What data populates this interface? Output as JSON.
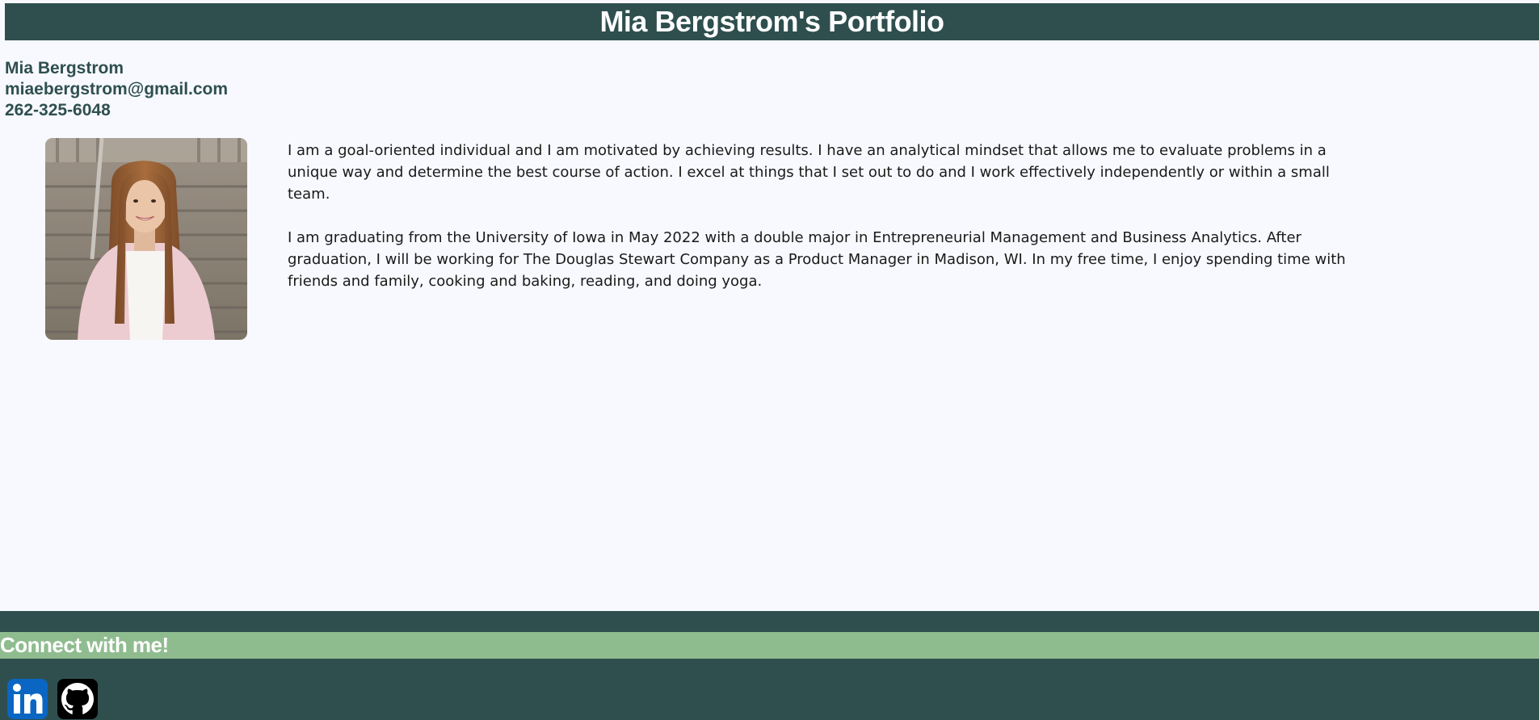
{
  "header": {
    "title": "Mia Bergstrom's Portfolio"
  },
  "contact": {
    "name": "Mia Bergstrom",
    "email": "miaebergstrom@gmail.com",
    "phone": "262-325-6048"
  },
  "bio": {
    "paragraph1": "I am a goal-oriented individual and I am motivated by achieving results. I have an analytical mindset that allows me to evaluate problems in a unique way and determine the best course of action. I excel at things that I set out to do and I work effectively independently or within a small team.",
    "paragraph2": "I am graduating from the University of Iowa in May 2022 with a double major in Entrepreneurial Management and Business Analytics. After graduation, I will be working for The Douglas Stewart Company as a Product Manager in Madison, WI. In my free time, I enjoy spending time with friends and family, cooking and baking, reading, and doing yoga."
  },
  "footer": {
    "connect_label": "Connect with me!",
    "social_icons": [
      "linkedin-icon",
      "github-icon"
    ]
  },
  "colors": {
    "primary": "#2f4f4f",
    "accent": "#8fbc8f",
    "background": "#f7f9fe",
    "linkedin": "#0a66c2"
  }
}
